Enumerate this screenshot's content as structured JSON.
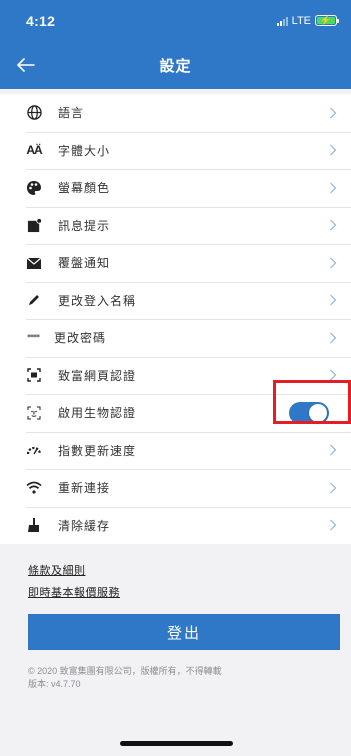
{
  "status_bar": {
    "time": "4:12",
    "network": "LTE"
  },
  "header": {
    "title": "設定",
    "back_icon": "arrow-left-icon"
  },
  "settings": [
    {
      "label": "語言",
      "icon": "globe-icon",
      "control": "chevron"
    },
    {
      "label": "字體大小",
      "icon": "font-size-icon",
      "icon_text": "AÄ",
      "control": "chevron"
    },
    {
      "label": "螢幕顏色",
      "icon": "palette-icon",
      "control": "chevron"
    },
    {
      "label": "訊息提示",
      "icon": "notification-icon",
      "control": "chevron"
    },
    {
      "label": "覆盤通知",
      "icon": "envelope-icon",
      "control": "chevron"
    },
    {
      "label": "更改登入名稱",
      "icon": "pencil-icon",
      "control": "chevron"
    },
    {
      "label": "更改密碼",
      "icon": "password-dots-icon",
      "icon_text": "****",
      "control": "chevron"
    },
    {
      "label": "致富網頁認證",
      "icon": "scan-icon",
      "control": "chevron"
    },
    {
      "label": "啟用生物認證",
      "icon": "face-id-icon",
      "control": "toggle",
      "enabled": true
    },
    {
      "label": "指數更新速度",
      "icon": "speedometer-icon",
      "control": "chevron"
    },
    {
      "label": "重新連接",
      "icon": "wifi-icon",
      "control": "chevron"
    },
    {
      "label": "清除緩存",
      "icon": "broom-icon",
      "control": "chevron"
    }
  ],
  "links": {
    "terms": "條款及細則",
    "quote_service": "即時基本報價服務"
  },
  "logout_label": "登出",
  "footer": {
    "copyright": "© 2020 致富集團有限公司，版權所有，不得轉載",
    "version": "版本: v4.7.70"
  },
  "colors": {
    "primary": "#2f78c8",
    "highlight": "#e31e24",
    "battery": "#4cd964"
  }
}
